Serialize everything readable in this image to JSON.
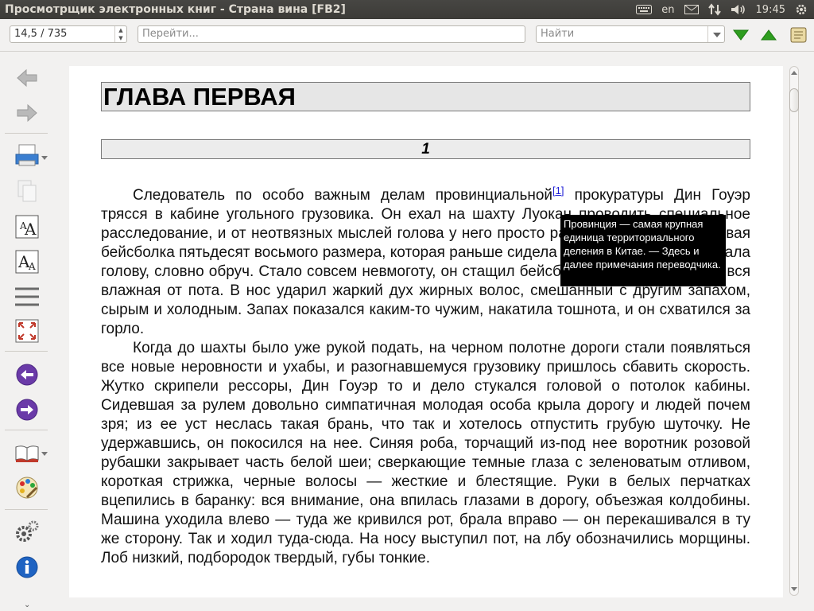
{
  "window": {
    "title": "Просмотрщик электронных книг - Страна вина [FB2]"
  },
  "tray": {
    "keyboard_layout": "en",
    "clock": "19:45"
  },
  "toolbar": {
    "page_position": "14,5 / 735",
    "goto_placeholder": "Перейти...",
    "find_placeholder": "Найти"
  },
  "document": {
    "chapter_title": "ГЛАВА ПЕРВАЯ",
    "section_number": "1",
    "footnote_ref": "[1]",
    "paragraphs": [
      {
        "before_note": "Следователь по особо важным делам провинциальной",
        "after_note": " прокуратуры Дин Гоуэр трясся в кабине угольного грузовика. Он ехал на шахту Луокан проводить специальное расследование, и от неотвязных мыслей голова у него просто раскалывалась. Коричневая бейсболка пятьдесят восьмого размера, которая раньше сидела свободно, теперь сжимала голову, словно обруч. Стало совсем невмоготу, он стащил бейсболку и увидел, что она вся влажная от пота. В нос ударил жаркий дух жирных волос, смешанный с другим запахом, сырым и холодным. Запах показался каким-то чужим, накатила тошнота, и он схватился за горло."
      },
      {
        "text": "Когда до шахты было уже рукой подать, на черном полотне дороги стали появляться все новые неровности и ухабы, и разогнавшемуся грузовику пришлось сбавить скорость. Жутко скрипели рессоры, Дин Гоуэр то и дело стукался головой о потолок кабины. Сидевшая за рулем довольно симпатичная молодая особа крыла дорогу и людей почем зря; из ее уст неслась такая брань, что так и хотелось отпустить грубую шуточку. Не удержавшись, он покосился на нее. Синяя роба, торчащий из-под нее воротник розовой рубашки закрывает часть белой шеи; сверкающие темные глаза с зеленоватым отливом, короткая стрижка, черные волосы — жесткие и блестящие. Руки в белых перчатках вцепились в баранку: вся внимание, она впилась глазами в дорогу, объезжая колдобины. Машина уходила влево — туда же кривился рот, брала вправо — он перекашивался в ту же сторону. Так и ходил туда-сюда. На носу выступил пот, на лбу обозначились морщины. Лоб низкий, подбородок твердый, губы тонкие."
      }
    ],
    "tooltip": "Провинция — самая крупная единица территориального деления в Китае. — Здесь и далее примечания переводчика."
  },
  "icons": {
    "accent_green": "#2e9d1f",
    "accent_purple": "#6a3aa8",
    "info_blue": "#1f63c2"
  }
}
